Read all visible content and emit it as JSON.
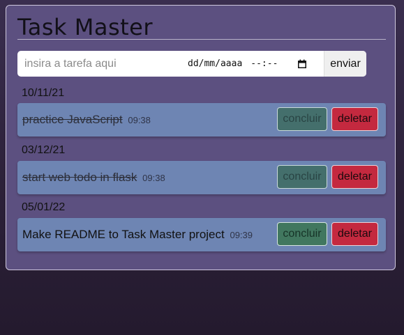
{
  "app": {
    "title": "Task Master"
  },
  "form": {
    "task_placeholder": "insira a tarefa aqui",
    "date_placeholder": "dd/mm/aaaa",
    "time_placeholder": "--:--",
    "submit_label": "enviar"
  },
  "groups": [
    {
      "date": "10/11/21",
      "task": {
        "text": "practice JavaScript",
        "time": "09:38",
        "done": true
      }
    },
    {
      "date": "03/12/21",
      "task": {
        "text": "start web todo in flask",
        "time": "09:38",
        "done": true
      }
    },
    {
      "date": "05/01/22",
      "task": {
        "text": "Make README to Task Master project",
        "time": "09:39",
        "done": false
      }
    }
  ],
  "actions": {
    "complete_label": "concluir",
    "delete_label": "deletar"
  },
  "colors": {
    "card_bg": "#5c5080",
    "task_bg": "#6e85b3",
    "complete_btn": "#41775f",
    "delete_btn": "#c4293f"
  },
  "icons": {
    "calendar": "calendar-icon"
  }
}
